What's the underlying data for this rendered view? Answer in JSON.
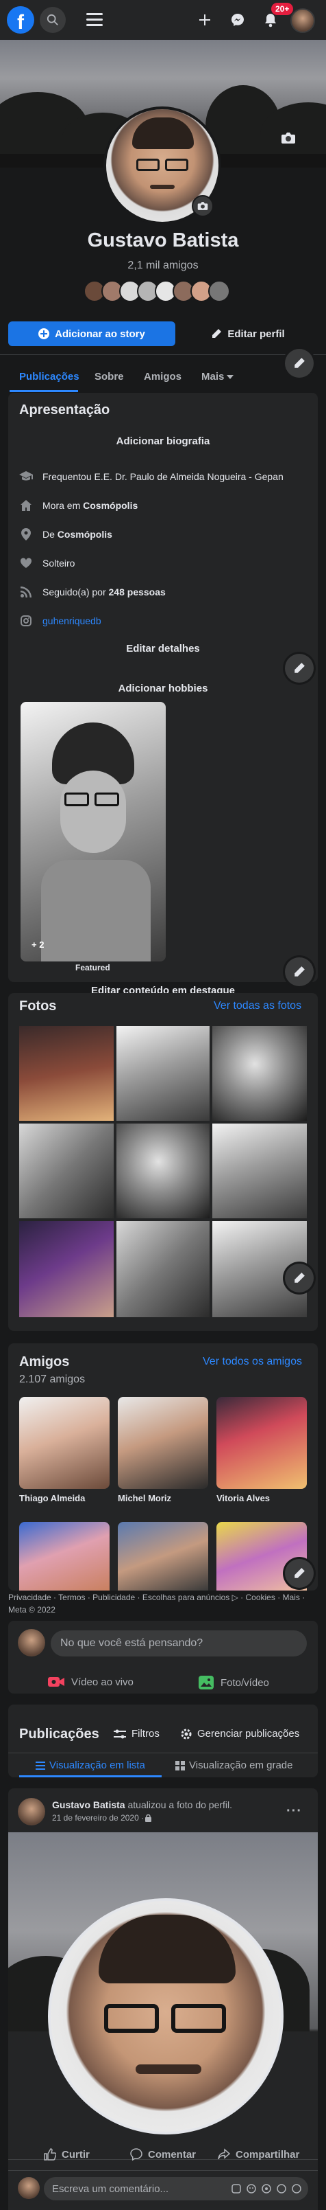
{
  "topbar": {
    "logo": "facebook-logo",
    "notifications_badge": "20+",
    "icons": [
      "search-icon",
      "menu-icon",
      "plus-icon",
      "messenger-icon",
      "bell-icon"
    ]
  },
  "profile": {
    "name": "Gustavo Batista",
    "friends_count": "2,1 mil amigos",
    "add_story": "Adicionar ao story",
    "edit_profile": "Editar perfil"
  },
  "tabs": [
    "Publicações",
    "Sobre",
    "Amigos",
    "Mais"
  ],
  "intro": {
    "title": "Apresentação",
    "add_bio": "Adicionar biografia",
    "items": [
      {
        "icon": "graduation-cap-icon",
        "text": "Frequentou E.E. Dr. Paulo de Almeida Nogueira - Gepan"
      },
      {
        "icon": "house-icon",
        "prefix": "Mora em ",
        "bold": "Cosmópolis"
      },
      {
        "icon": "location-pin-icon",
        "prefix": "De ",
        "bold": "Cosmópolis"
      },
      {
        "icon": "heart-icon",
        "text": "Solteiro"
      },
      {
        "icon": "rss-icon",
        "prefix": "Seguido(a) por ",
        "bold": "248 pessoas"
      },
      {
        "icon": "instagram-icon",
        "link": "guhenriquedb"
      }
    ],
    "edit_details": "Editar detalhes",
    "add_hobbies": "Adicionar hobbies",
    "featured_count": "+ 2",
    "featured_label": "Featured",
    "edit_featured": "Editar conteúdo em destaque"
  },
  "photos": {
    "title": "Fotos",
    "see_all": "Ver todas as fotos"
  },
  "friends": {
    "title": "Amigos",
    "count": "2.107 amigos",
    "see_all": "Ver todos os amigos",
    "list": [
      "Thiago Almeida",
      "Michel Moriz",
      "Vitoria Alves"
    ]
  },
  "footer": {
    "links": "Privacidade · Termos · Publicidade · Escolhas para anúncios ▷ · Cookies · Mais ·",
    "copyright": "Meta © 2022"
  },
  "composer": {
    "placeholder": "No que você está pensando?",
    "live": "Vídeo ao vivo",
    "photo": "Foto/vídeo"
  },
  "posts_header": {
    "title": "Publicações",
    "filters": "Filtros",
    "manage": "Gerenciar publicações",
    "list_view": "Visualização em lista",
    "grid_view": "Visualização em grade"
  },
  "post": {
    "author": "Gustavo Batista",
    "action": " atualizou a foto do perfil.",
    "date": "21 de fevereiro de 2020 · ",
    "like": "Curtir",
    "comment": "Comentar",
    "share": "Compartilhar",
    "comment_placeholder": "Escreva um comentário..."
  },
  "colors": {
    "background": "#18191a",
    "card": "#242526",
    "accent": "#1b74e4",
    "link": "#2d88ff",
    "badge": "#e41e3f"
  }
}
